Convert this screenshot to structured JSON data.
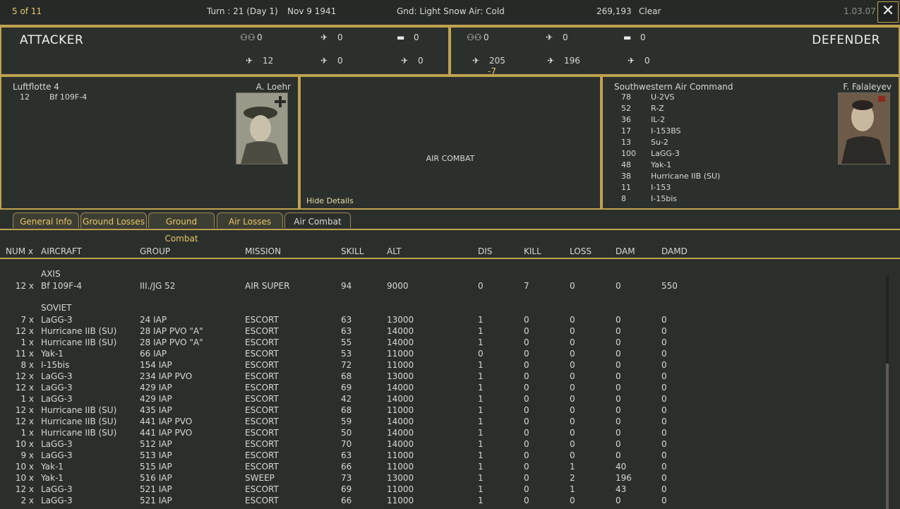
{
  "topbar": {
    "counter": "5 of 11",
    "turn": "Turn : 21 (Day 1)",
    "date": "Nov 9 1941",
    "ground": "Gnd: Light Snow",
    "air": "Air: Cold",
    "score": "269,193",
    "weather": "Clear",
    "version": "1.03.07",
    "close_label": "✕"
  },
  "attacker": {
    "title": "ATTACKER",
    "stats": {
      "men": "0",
      "tac": "0",
      "tanks": "0",
      "fighters": "12",
      "bombers": "0",
      "other": "0"
    },
    "command": "Luftflotte 4",
    "leader": "A. Loehr",
    "units": [
      {
        "num": "12",
        "name": "Bf 109F-4"
      }
    ]
  },
  "defender": {
    "title": "DEFENDER",
    "stats": {
      "men": "0",
      "tac": "0",
      "tanks": "0",
      "fighters": "205",
      "fighters_delta": "-7",
      "bombers": "196",
      "other": "0"
    },
    "command": "Southwestern Air Command",
    "leader": "F. Falaleyev",
    "units": [
      {
        "num": "78",
        "name": "U-2VS"
      },
      {
        "num": "52",
        "name": "R-Z"
      },
      {
        "num": "36",
        "name": "IL-2"
      },
      {
        "num": "17",
        "name": "I-153BS"
      },
      {
        "num": "13",
        "name": "Su-2"
      },
      {
        "num": "100",
        "name": "LaGG-3"
      },
      {
        "num": "48",
        "name": "Yak-1"
      },
      {
        "num": "38",
        "name": "Hurricane IIB (SU)"
      },
      {
        "num": "11",
        "name": "I-153"
      },
      {
        "num": "8",
        "name": "I-15bis"
      }
    ]
  },
  "center": {
    "label": "AIR COMBAT",
    "hide_details": "Hide Details"
  },
  "tabs": [
    "General Info",
    "Ground Losses",
    "Ground Combat",
    "Air Losses",
    "Air Combat"
  ],
  "active_tab": "Air Combat",
  "table": {
    "headers": [
      "NUM x",
      "AIRCRAFT",
      "GROUP",
      "MISSION",
      "SKILL",
      "ALT",
      "DIS",
      "KILL",
      "LOSS",
      "DAM",
      "DAMD"
    ],
    "axis_label": "AXIS",
    "axis_rows": [
      {
        "num": "12 x",
        "aircraft": "Bf 109F-4",
        "group": "III./JG 52",
        "mission": "AIR SUPER",
        "skill": "94",
        "alt": "9000",
        "dis": "0",
        "kill": "7",
        "loss": "0",
        "dam": "0",
        "damd": "550"
      }
    ],
    "soviet_label": "SOVIET",
    "soviet_rows": [
      {
        "num": "7 x",
        "aircraft": "LaGG-3",
        "group": "24 IAP",
        "mission": "ESCORT",
        "skill": "63",
        "alt": "13000",
        "dis": "1",
        "kill": "0",
        "loss": "0",
        "dam": "0",
        "damd": "0"
      },
      {
        "num": "12 x",
        "aircraft": "Hurricane IIB (SU)",
        "group": "28 IAP PVO \"A\"",
        "mission": "ESCORT",
        "skill": "63",
        "alt": "14000",
        "dis": "1",
        "kill": "0",
        "loss": "0",
        "dam": "0",
        "damd": "0"
      },
      {
        "num": "1 x",
        "aircraft": "Hurricane IIB (SU)",
        "group": "28 IAP PVO \"A\"",
        "mission": "ESCORT",
        "skill": "55",
        "alt": "14000",
        "dis": "1",
        "kill": "0",
        "loss": "0",
        "dam": "0",
        "damd": "0"
      },
      {
        "num": "11 x",
        "aircraft": "Yak-1",
        "group": "66 IAP",
        "mission": "ESCORT",
        "skill": "53",
        "alt": "11000",
        "dis": "0",
        "kill": "0",
        "loss": "0",
        "dam": "0",
        "damd": "0"
      },
      {
        "num": "8 x",
        "aircraft": "I-15bis",
        "group": "154 IAP",
        "mission": "ESCORT",
        "skill": "72",
        "alt": "11000",
        "dis": "1",
        "kill": "0",
        "loss": "0",
        "dam": "0",
        "damd": "0"
      },
      {
        "num": "12 x",
        "aircraft": "LaGG-3",
        "group": "234 IAP PVO",
        "mission": "ESCORT",
        "skill": "68",
        "alt": "13000",
        "dis": "1",
        "kill": "0",
        "loss": "0",
        "dam": "0",
        "damd": "0"
      },
      {
        "num": "12 x",
        "aircraft": "LaGG-3",
        "group": "429 IAP",
        "mission": "ESCORT",
        "skill": "69",
        "alt": "14000",
        "dis": "1",
        "kill": "0",
        "loss": "0",
        "dam": "0",
        "damd": "0"
      },
      {
        "num": "1 x",
        "aircraft": "LaGG-3",
        "group": "429 IAP",
        "mission": "ESCORT",
        "skill": "42",
        "alt": "14000",
        "dis": "1",
        "kill": "0",
        "loss": "0",
        "dam": "0",
        "damd": "0"
      },
      {
        "num": "12 x",
        "aircraft": "Hurricane IIB (SU)",
        "group": "435 IAP",
        "mission": "ESCORT",
        "skill": "68",
        "alt": "11000",
        "dis": "1",
        "kill": "0",
        "loss": "0",
        "dam": "0",
        "damd": "0"
      },
      {
        "num": "12 x",
        "aircraft": "Hurricane IIB (SU)",
        "group": "441 IAP PVO",
        "mission": "ESCORT",
        "skill": "59",
        "alt": "14000",
        "dis": "1",
        "kill": "0",
        "loss": "0",
        "dam": "0",
        "damd": "0"
      },
      {
        "num": "1 x",
        "aircraft": "Hurricane IIB (SU)",
        "group": "441 IAP PVO",
        "mission": "ESCORT",
        "skill": "50",
        "alt": "14000",
        "dis": "1",
        "kill": "0",
        "loss": "0",
        "dam": "0",
        "damd": "0"
      },
      {
        "num": "10 x",
        "aircraft": "LaGG-3",
        "group": "512 IAP",
        "mission": "ESCORT",
        "skill": "70",
        "alt": "14000",
        "dis": "1",
        "kill": "0",
        "loss": "0",
        "dam": "0",
        "damd": "0"
      },
      {
        "num": "9 x",
        "aircraft": "LaGG-3",
        "group": "513 IAP",
        "mission": "ESCORT",
        "skill": "63",
        "alt": "11000",
        "dis": "1",
        "kill": "0",
        "loss": "0",
        "dam": "0",
        "damd": "0"
      },
      {
        "num": "10 x",
        "aircraft": "Yak-1",
        "group": "515 IAP",
        "mission": "ESCORT",
        "skill": "66",
        "alt": "11000",
        "dis": "1",
        "kill": "0",
        "loss": "1",
        "dam": "40",
        "damd": "0"
      },
      {
        "num": "10 x",
        "aircraft": "Yak-1",
        "group": "516 IAP",
        "mission": "SWEEP",
        "skill": "73",
        "alt": "13000",
        "dis": "1",
        "kill": "0",
        "loss": "2",
        "dam": "196",
        "damd": "0"
      },
      {
        "num": "12 x",
        "aircraft": "LaGG-3",
        "group": "521 IAP",
        "mission": "ESCORT",
        "skill": "69",
        "alt": "11000",
        "dis": "1",
        "kill": "0",
        "loss": "1",
        "dam": "43",
        "damd": "0"
      },
      {
        "num": "2 x",
        "aircraft": "LaGG-3",
        "group": "521 IAP",
        "mission": "ESCORT",
        "skill": "66",
        "alt": "11000",
        "dis": "1",
        "kill": "0",
        "loss": "0",
        "dam": "0",
        "damd": "0"
      }
    ]
  },
  "icons": {
    "men": "infantry-icon",
    "tac": "ground-attack-plane-icon",
    "tanks": "tank-icon",
    "fighters": "fighter-icon",
    "bombers": "bomber-icon",
    "other": "transport-plane-icon"
  },
  "colors": {
    "accent": "#bfa24f",
    "highlight": "#e6c66a",
    "background": "#2b2f2c"
  }
}
